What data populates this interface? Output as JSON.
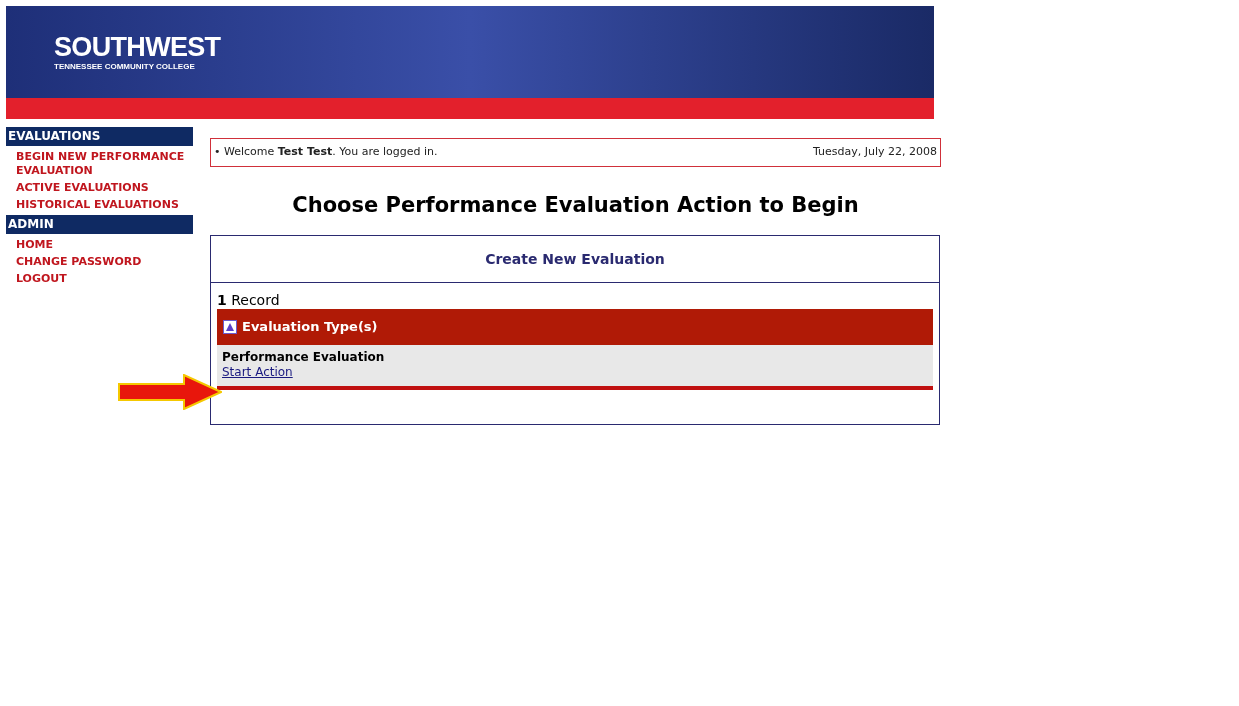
{
  "header": {
    "logo_title": "SOUTHWEST",
    "logo_subtitle": "TENNESSEE COMMUNITY COLLEGE"
  },
  "sidebar": {
    "sections": [
      {
        "title": "EVALUATIONS",
        "items": [
          "BEGIN NEW PERFORMANCE EVALUATION",
          "ACTIVE EVALUATIONS",
          "HISTORICAL EVALUATIONS"
        ]
      },
      {
        "title": "ADMIN",
        "items": [
          "HOME",
          "CHANGE PASSWORD",
          "LOGOUT"
        ]
      }
    ]
  },
  "welcome_bar": {
    "message": "• Welcome **Test Test**. You are logged in.",
    "date": "Tuesday, July 22, 2008"
  },
  "page_title": "Choose Performance Evaluation Action to Begin",
  "panel": {
    "title": "Create New Evaluation",
    "record_count": "**1** Record",
    "group_header": "Evaluation Type(s)",
    "rows": [
      {
        "name": "Performance Evaluation",
        "action": "Start Action"
      }
    ]
  }
}
